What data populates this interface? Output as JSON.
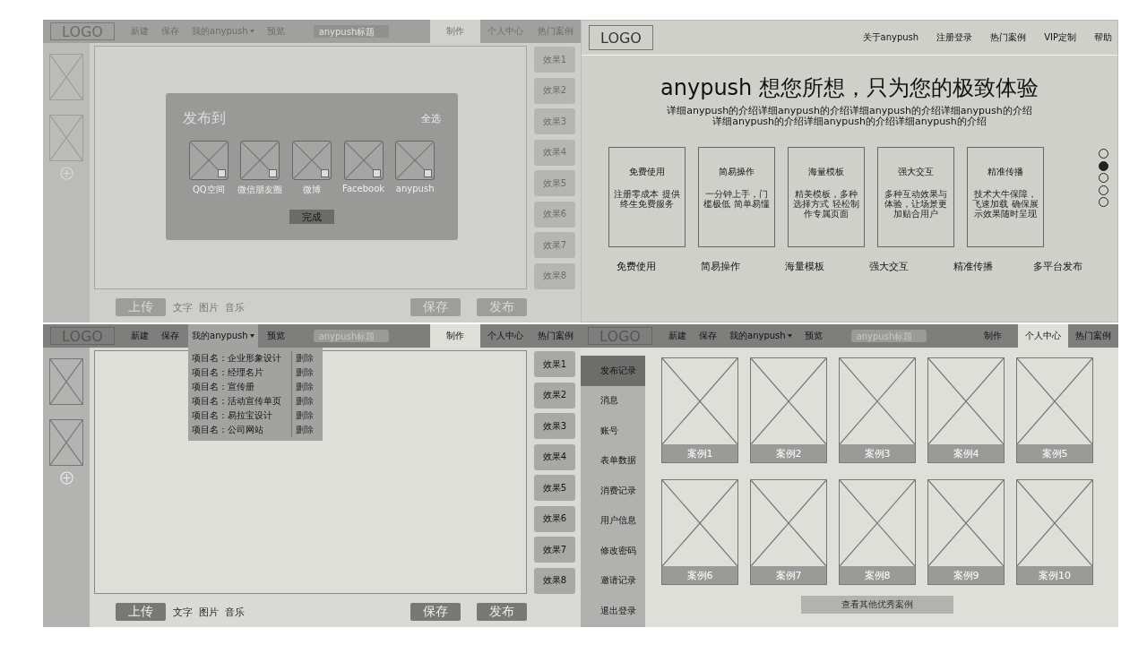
{
  "editor_publish": {
    "header": {
      "logo": "LOGO",
      "nav": [
        {
          "label": "新建",
          "kind": "link"
        },
        {
          "label": "保存",
          "kind": "link"
        },
        {
          "label": "我的anypush",
          "kind": "dropdown",
          "expanded": false
        },
        {
          "label": "预览",
          "kind": "link"
        }
      ],
      "search": {
        "placeholder": "anypush标题"
      },
      "tabs": [
        {
          "label": "制作",
          "selected": true
        },
        {
          "label": "个人中心",
          "selected": false
        },
        {
          "label": "热门案例",
          "selected": false
        }
      ]
    },
    "effects": [
      "效果1",
      "效果2",
      "效果3",
      "效果4",
      "效果5",
      "效果6",
      "效果7",
      "效果8"
    ],
    "toolbar": {
      "upload": "上传",
      "tools": [
        "文字",
        "图片",
        "音乐"
      ],
      "save": "保存",
      "publish": "发布"
    },
    "dialog": {
      "title": "发布到",
      "select_all": "全选",
      "platforms": [
        {
          "label": "QQ空间",
          "checked": false
        },
        {
          "label": "微信朋友圈",
          "checked": false
        },
        {
          "label": "微博",
          "checked": false
        },
        {
          "label": "Facebook",
          "checked": false
        },
        {
          "label": "anypush",
          "checked": false
        }
      ],
      "confirm": "完成"
    }
  },
  "landing": {
    "logo": "LOGO",
    "nav": [
      "关于anypush",
      "注册登录",
      "热门案例",
      "VIP定制",
      "帮助"
    ],
    "title": "anypush 想您所想，只为您的极致体验",
    "subtitle": [
      "详细anypush的介绍详细anypush的介绍详细anypush的介绍详细anypush的介绍",
      "详细anypush的介绍详细anypush的介绍详细anypush的介绍"
    ],
    "features": [
      {
        "title": "免费使用",
        "description": "注册零成本 提供终生免费服务"
      },
      {
        "title": "简易操作",
        "description": "一分钟上手，门槛极低 简单易懂"
      },
      {
        "title": "海量模板",
        "description": "精美模板，多种选择方式 轻松制作专属页面"
      },
      {
        "title": "强大交互",
        "description": "多种互动效果与体验，让场景更加贴合用户"
      },
      {
        "title": "精准传播",
        "description": "技术大牛保障，飞速加载 确保展示效果随时呈现"
      }
    ],
    "carousel_dots": [
      {
        "selected": false
      },
      {
        "selected": true
      },
      {
        "selected": false
      },
      {
        "selected": false
      },
      {
        "selected": false
      }
    ],
    "feature_labels": [
      "免费使用",
      "简易操作",
      "海量模板",
      "强大交互",
      "精准传播",
      "多平台发布"
    ]
  },
  "editor_menu": {
    "header": {
      "logo": "LOGO",
      "nav": [
        {
          "label": "新建",
          "kind": "link"
        },
        {
          "label": "保存",
          "kind": "link"
        },
        {
          "label": "我的anypush",
          "kind": "dropdown",
          "expanded": true
        },
        {
          "label": "预览",
          "kind": "link"
        }
      ],
      "search": {
        "placeholder": "anypush标题"
      },
      "tabs": [
        {
          "label": "制作",
          "selected": true
        },
        {
          "label": "个人中心",
          "selected": false
        },
        {
          "label": "热门案例",
          "selected": false
        }
      ]
    },
    "dropdown_menu": [
      {
        "label": "项目名：企业形象设计",
        "action": "删除"
      },
      {
        "label": "项目名：经理名片",
        "action": "删除"
      },
      {
        "label": "项目名：宣传册",
        "action": "删除"
      },
      {
        "label": "项目名：活动宣传单页",
        "action": "删除"
      },
      {
        "label": "项目名：易拉宝设计",
        "action": "删除"
      },
      {
        "label": "项目名：公司网站",
        "action": "删除"
      }
    ],
    "effects": [
      "效果1",
      "效果2",
      "效果3",
      "效果4",
      "效果5",
      "效果6",
      "效果7",
      "效果8"
    ],
    "toolbar": {
      "upload": "上传",
      "tools": [
        "文字",
        "图片",
        "音乐"
      ],
      "save": "保存",
      "publish": "发布"
    }
  },
  "profile": {
    "header": {
      "logo": "LOGO",
      "nav": [
        {
          "label": "新建",
          "kind": "link"
        },
        {
          "label": "保存",
          "kind": "link"
        },
        {
          "label": "我的anypush",
          "kind": "dropdown",
          "expanded": false
        },
        {
          "label": "预览",
          "kind": "link"
        }
      ],
      "search": {
        "placeholder": "anypush标题"
      },
      "tabs": [
        {
          "label": "制作",
          "selected": false
        },
        {
          "label": "个人中心",
          "selected": true
        },
        {
          "label": "热门案例",
          "selected": false
        }
      ]
    },
    "sidebar": [
      {
        "label": "发布记录",
        "selected": true
      },
      {
        "label": "消息",
        "selected": false
      },
      {
        "label": "账号",
        "selected": false
      },
      {
        "label": "表单数据",
        "selected": false
      },
      {
        "label": "消费记录",
        "selected": false
      },
      {
        "label": "用户信息",
        "selected": false
      },
      {
        "label": "修改密码",
        "selected": false
      },
      {
        "label": "邀请记录",
        "selected": false
      },
      {
        "label": "退出登录",
        "selected": false
      }
    ],
    "cases": [
      "案例1",
      "案例2",
      "案例3",
      "案例4",
      "案例5",
      "案例6",
      "案例7",
      "案例8",
      "案例9",
      "案例10"
    ],
    "more_button": "查看其他优秀案例"
  }
}
